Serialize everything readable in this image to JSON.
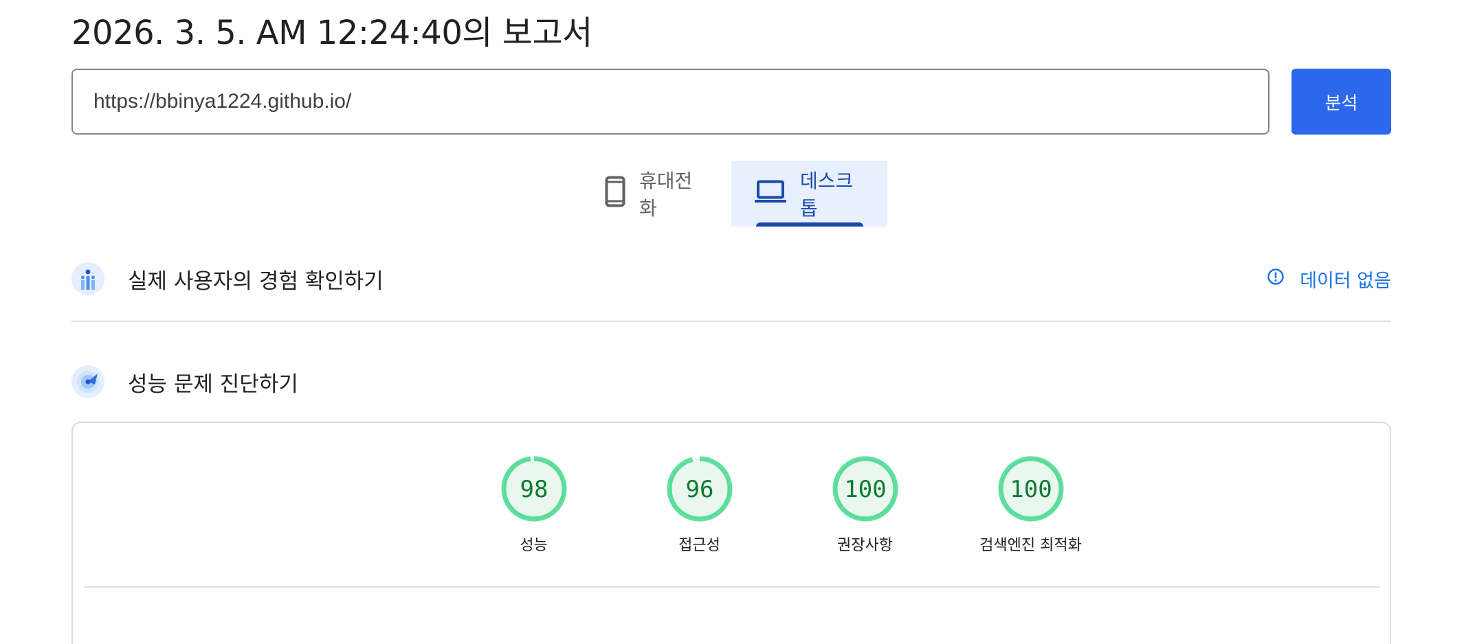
{
  "report": {
    "title": "2026. 3. 5. AM 12:24:40의 보고서"
  },
  "url_input": {
    "value": "https://bbinya1224.github.io/"
  },
  "analyze_button": {
    "label": "분석"
  },
  "device_tabs": [
    {
      "label": "휴대전화",
      "icon": "smartphone-icon",
      "selected": false
    },
    {
      "label": "데스크톱",
      "icon": "laptop-icon",
      "selected": true
    }
  ],
  "field_data": {
    "title": "실제 사용자의 경험 확인하기",
    "status": "데이터 없음",
    "icon": "users-chart-icon",
    "status_icon": "alert-circle-icon"
  },
  "lab_data": {
    "title": "성능 문제 진단하기",
    "icon": "radar-icon"
  },
  "scores": [
    {
      "value": "98",
      "label": "성능",
      "fraction": 0.98
    },
    {
      "value": "96",
      "label": "접근성",
      "fraction": 0.96
    },
    {
      "value": "100",
      "label": "권장사항",
      "fraction": 1.0
    },
    {
      "value": "100",
      "label": "검색엔진 최적화",
      "fraction": 1.0
    }
  ],
  "colors": {
    "accent": "#2c67ec",
    "tab_selected": "#1a4aa8",
    "link": "#1a73e8",
    "score_good": "#0cce6b",
    "score_text": "#0c7a2f"
  }
}
